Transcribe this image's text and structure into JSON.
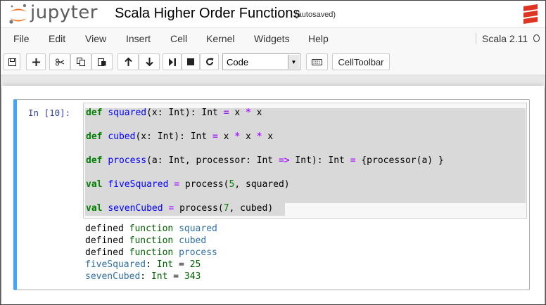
{
  "header": {
    "logo_text": "jupyter",
    "notebook_title": "Scala Higher Order Functions",
    "autosave_status": "(autosaved)",
    "brand_color": "#f37726"
  },
  "menu": {
    "items": [
      "File",
      "Edit",
      "View",
      "Insert",
      "Cell",
      "Kernel",
      "Widgets",
      "Help"
    ],
    "kernel_name": "Scala 2.11"
  },
  "toolbar": {
    "cell_type": "Code",
    "cell_toolbar_label": "CellToolbar",
    "icons": [
      "save-icon",
      "add-icon",
      "cut-icon",
      "copy-icon",
      "paste-icon",
      "move-up-icon",
      "move-down-icon",
      "run-icon",
      "stop-icon",
      "restart-icon",
      "keyboard-icon"
    ]
  },
  "cell": {
    "prompt": "In [10]:",
    "code": [
      "def squared(x: Int): Int = x * x",
      "def cubed(x: Int): Int = x * x * x",
      "def process(a: Int, processor: Int => Int): Int = {processor(a) }",
      "val fiveSquared = process(5, squared)",
      "val sevenCubed = process(7, cubed)"
    ],
    "output": [
      "defined function squared",
      "defined function cubed",
      "defined function process",
      "fiveSquared: Int = 25",
      "sevenCubed: Int = 343"
    ]
  }
}
